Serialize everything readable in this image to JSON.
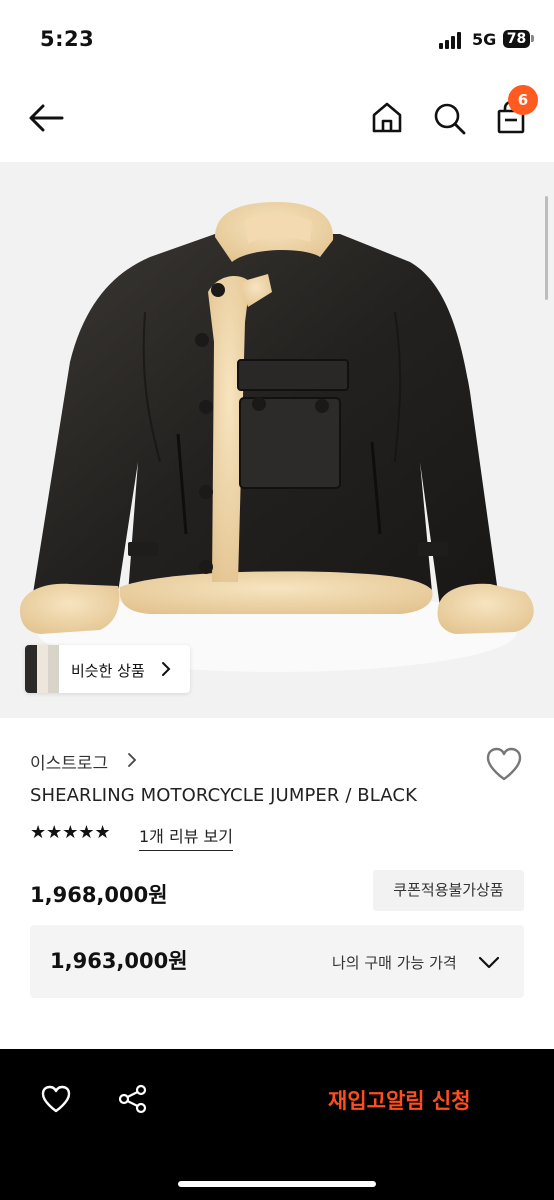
{
  "status": {
    "time": "5:23",
    "network": "5G",
    "battery": "78"
  },
  "nav": {
    "back_icon": "back-arrow-icon",
    "home_icon": "home-icon",
    "search_icon": "search-icon",
    "cart_icon": "shopping-bag-icon",
    "cart_count": "6"
  },
  "product_image": {
    "similar_label": "비슷한 상품"
  },
  "product": {
    "brand": "이스트로그",
    "name": "SHEARLING MOTORCYCLE JUMPER / BLACK",
    "stars": "★★★★★",
    "rating": 5,
    "review_link": "1개 리뷰 보기",
    "price": "1,968,000원",
    "coupon_badge": "쿠폰적용불가상품",
    "my_price": "1,963,000원",
    "my_price_label": "나의 구매 가능 가격"
  },
  "bottom_bar": {
    "restock_label": "재입고알림 신청"
  },
  "colors": {
    "accent": "#ff5a1f",
    "restock": "#ff4d1f"
  }
}
